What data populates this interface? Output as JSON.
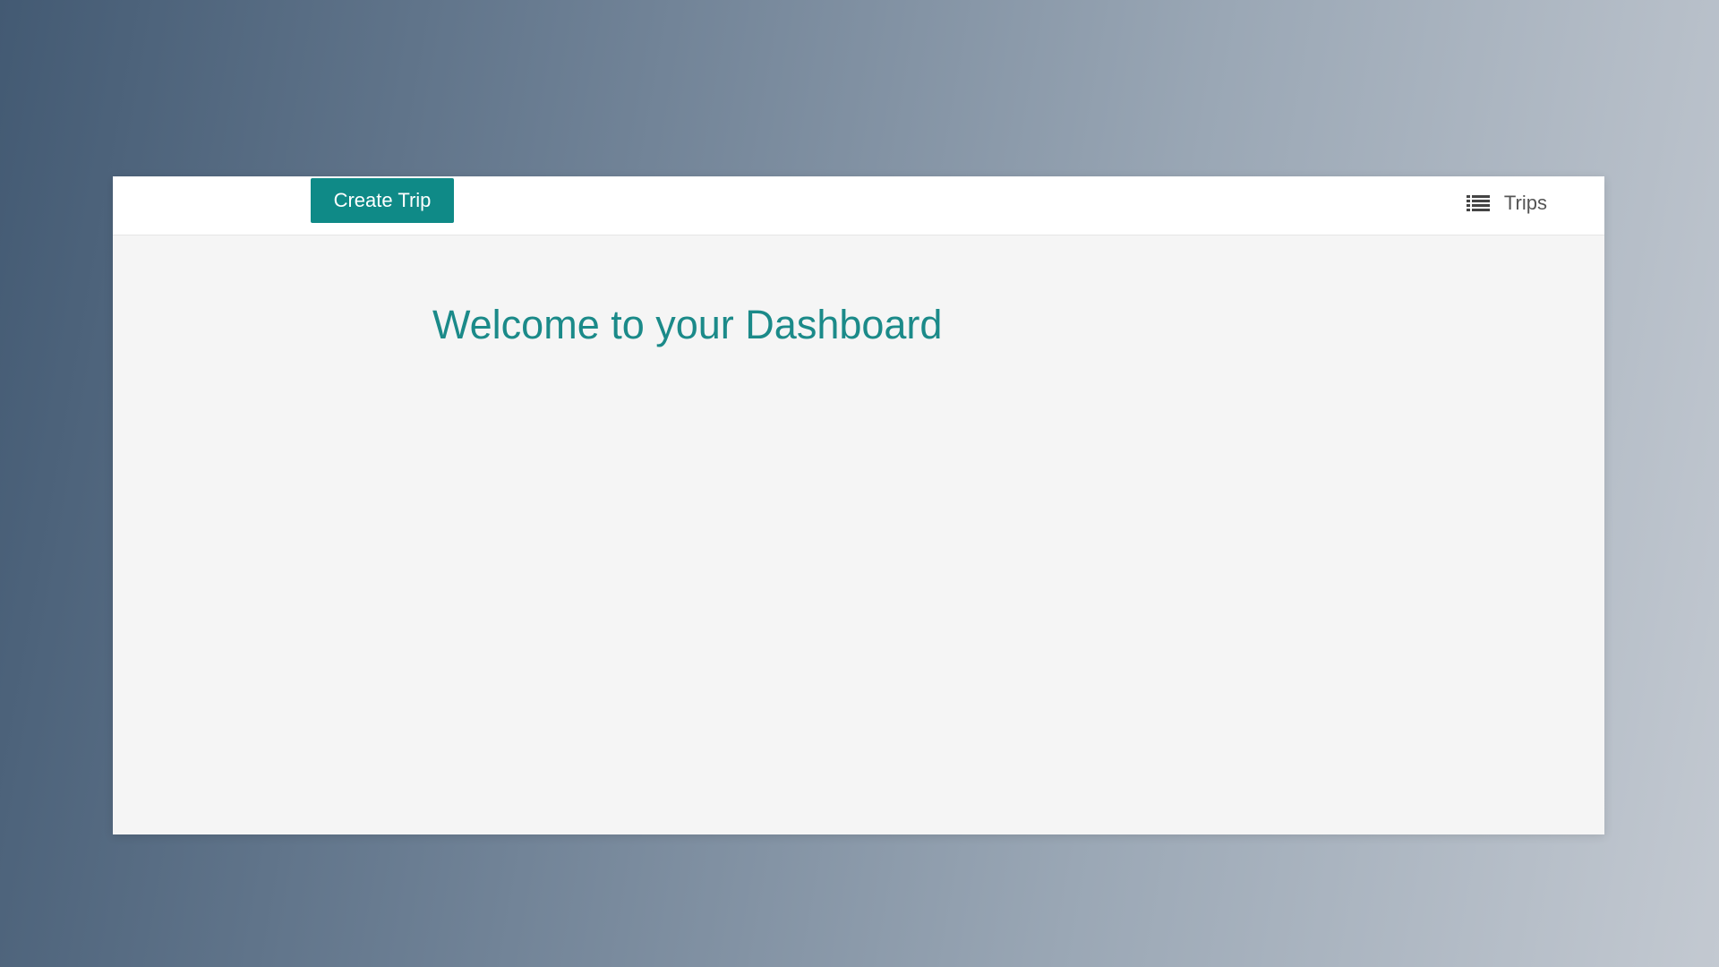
{
  "toolbar": {
    "create_trip_label": "Create Trip"
  },
  "nav": {
    "trips_label": "Trips",
    "trips_icon": "list-icon"
  },
  "main": {
    "title": "Welcome to your Dashboard"
  },
  "colors": {
    "accent": "#0f8a87",
    "title": "#1b8a89",
    "nav_text": "#555555",
    "content_bg": "#f5f5f5",
    "header_bg": "#ffffff"
  }
}
